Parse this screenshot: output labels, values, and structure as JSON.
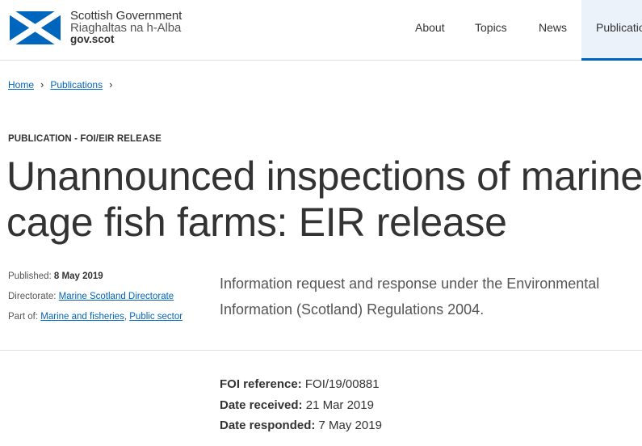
{
  "header": {
    "logo": {
      "line1": "Scottish Government",
      "line2": "Riaghaltas na h-Alba",
      "line3": "gov.scot"
    },
    "nav": [
      {
        "label": "About"
      },
      {
        "label": "Topics"
      },
      {
        "label": "News"
      },
      {
        "label": "Publications"
      }
    ],
    "active_nav": "Publications"
  },
  "breadcrumb": [
    {
      "label": "Home"
    },
    {
      "label": "Publications"
    }
  ],
  "publication": {
    "type_label": "PUBLICATION - FOI/EIR RELEASE",
    "title": "Unannounced inspections of marine cage fish farms: EIR release",
    "summary": "Information request and response under the Environmental Information (Scotland) Regulations 2004."
  },
  "meta": {
    "published_label": "Published:",
    "published_value": "8 May 2019",
    "directorate_label": "Directorate:",
    "directorate_value": "Marine Scotland Directorate",
    "partof_label": "Part of:",
    "partof_items": [
      "Marine and fisheries",
      "Public sector"
    ],
    "partof_separator": ","
  },
  "facts": {
    "foi_label": "FOI reference:",
    "foi_value": "FOI/19/00881",
    "received_label": "Date received:",
    "received_value": "21 Mar 2019",
    "responded_label": "Date responded:",
    "responded_value": "7 May 2019"
  },
  "colors": {
    "link": "#0065bd",
    "flag_blue": "#0065bd",
    "text": "#333333",
    "nav_active_bg": "#ebf2f9"
  }
}
